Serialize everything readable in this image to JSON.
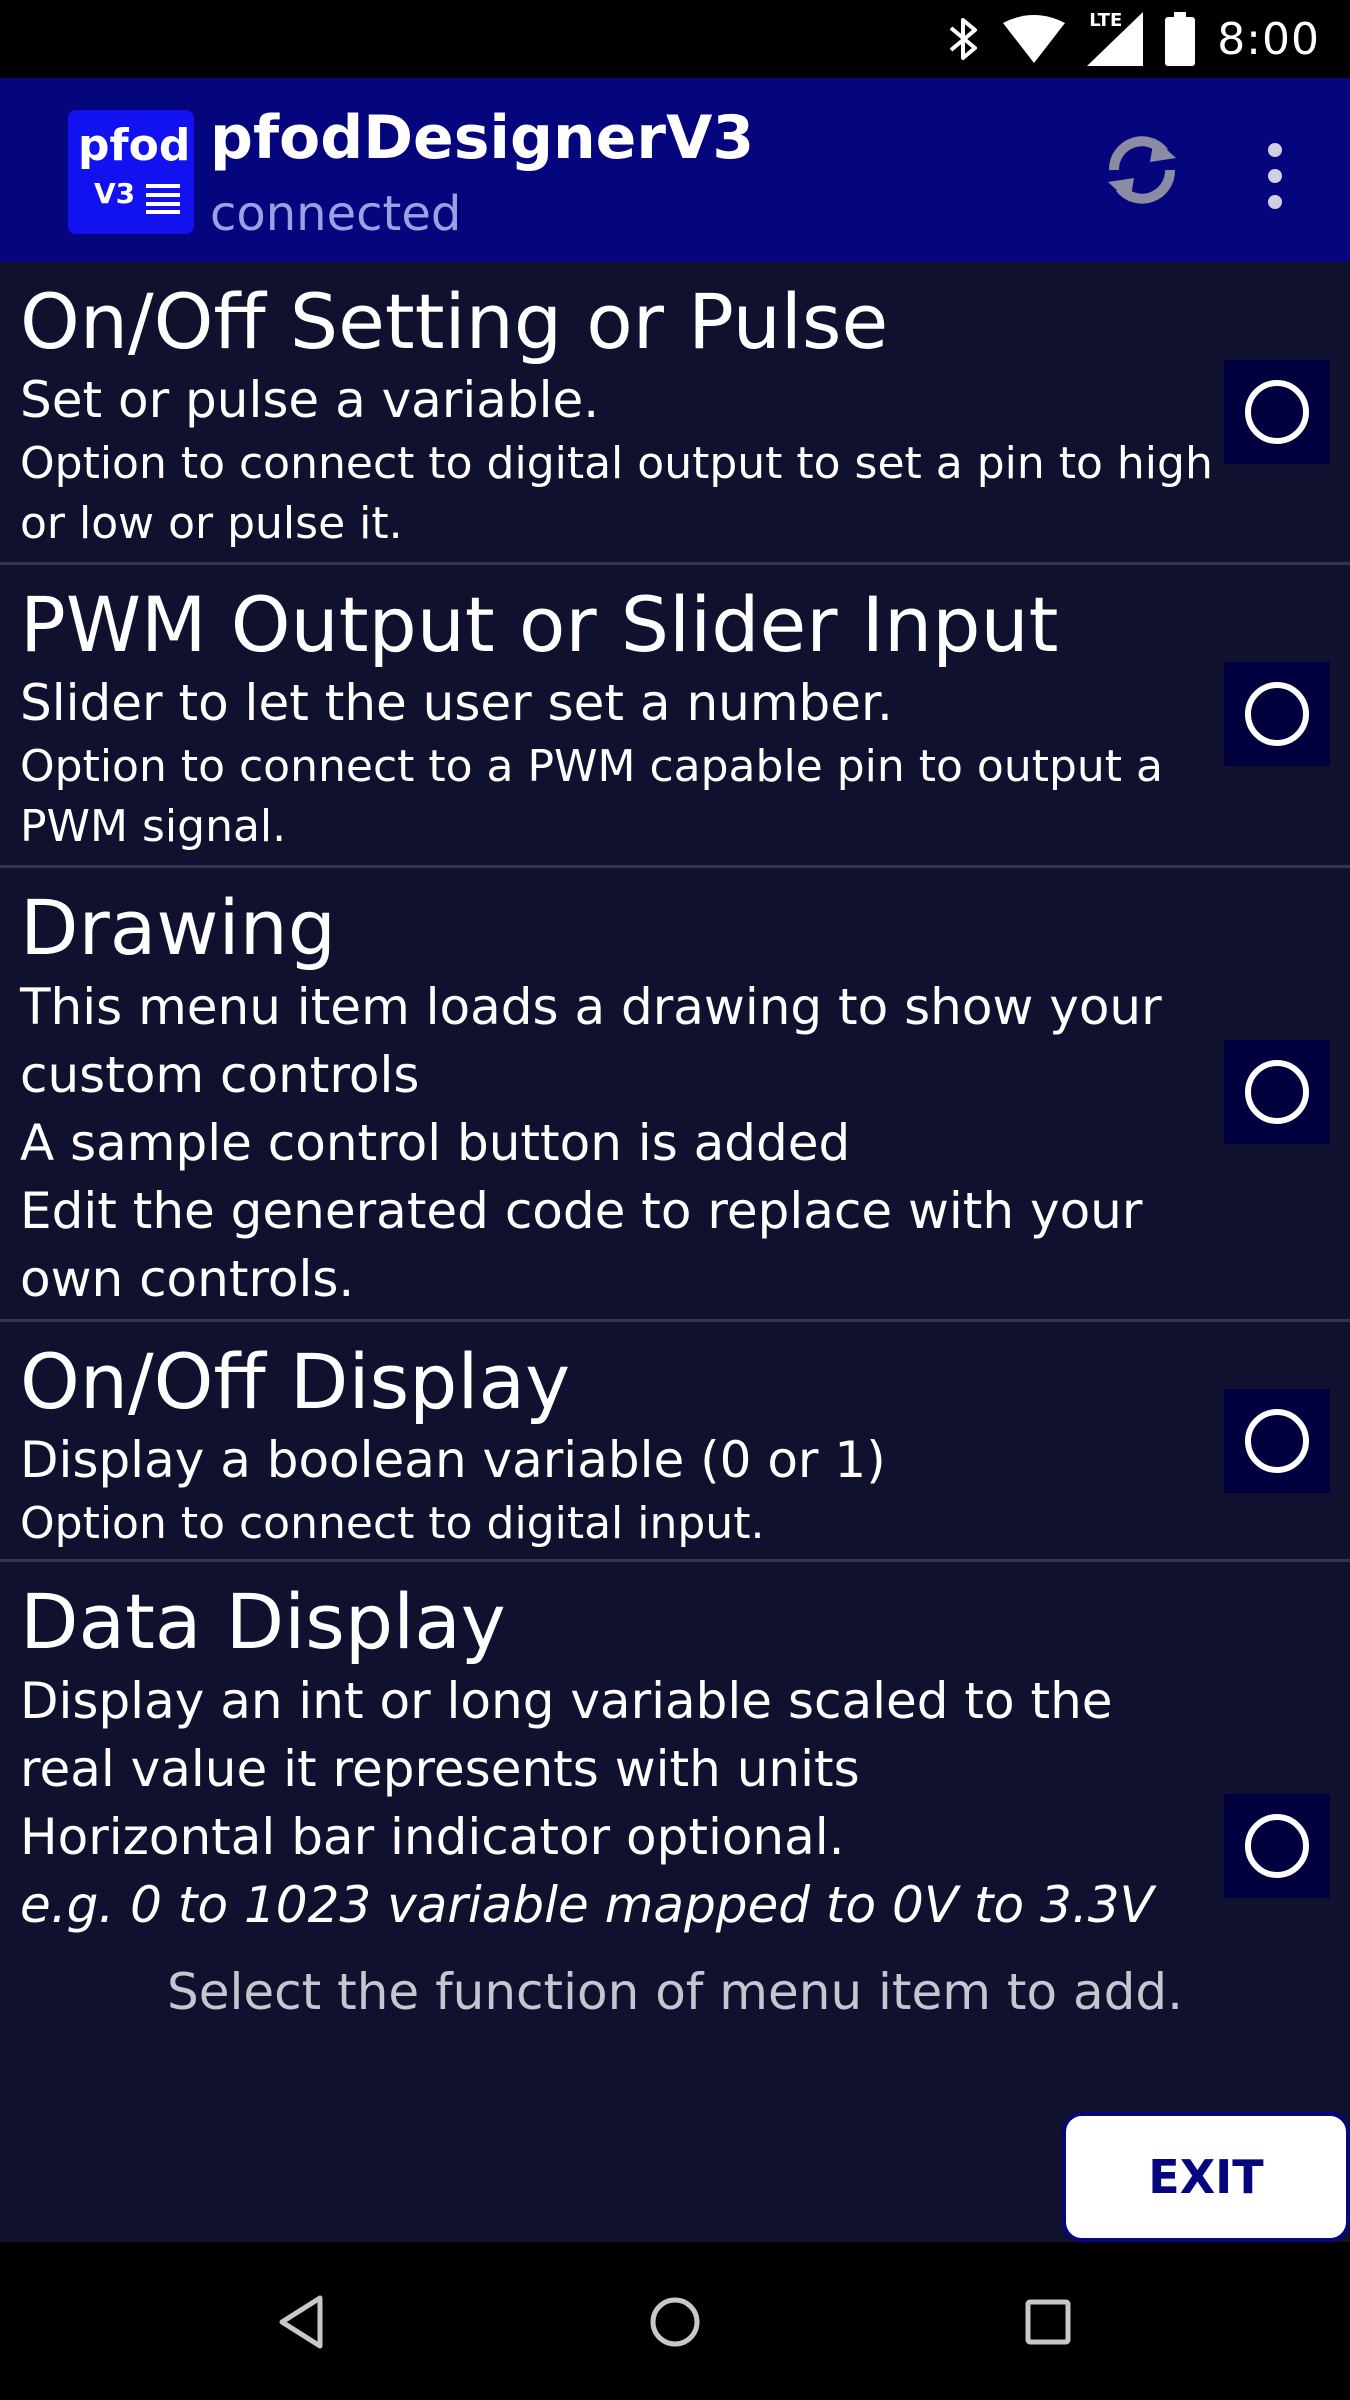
{
  "status_bar": {
    "network_label": "LTE",
    "time": "8:00",
    "icons": [
      "bluetooth-icon",
      "wifi-icon",
      "signal-icon",
      "battery-icon"
    ]
  },
  "app_bar": {
    "logo_line1": "pfod",
    "logo_line2": "V3",
    "title": "pfodDesignerV3",
    "subtitle": "connected",
    "icons": [
      "refresh-icon",
      "overflow-menu-icon"
    ]
  },
  "menu_items": [
    {
      "title": "On/Off Setting or Pulse",
      "subtitle": "Set or pulse a variable.",
      "detail": "Option to connect to digital output to set a pin to high or low or pulse it."
    },
    {
      "title": "PWM Output or Slider Input",
      "subtitle": "Slider to let the user set a number.",
      "detail": "Option to connect to a PWM capable pin to output a PWM signal."
    },
    {
      "title": "Drawing",
      "lines": [
        "This menu item loads a drawing to show your",
        "custom controls",
        "A sample control button is added",
        "Edit the generated code to replace with your",
        "own controls."
      ]
    },
    {
      "title": "On/Off Display",
      "subtitle": "Display a boolean variable (0 or 1)",
      "detail": "Option to connect to digital input."
    },
    {
      "title": "Data Display",
      "lines": [
        "Display an int or long variable scaled to the",
        "real value it represents with units",
        "Horizontal bar indicator optional."
      ],
      "example": "e.g. 0 to 1023 variable mapped to 0V to 3.3V"
    }
  ],
  "hint": "Select the function of menu item to add.",
  "exit_label": "EXIT",
  "nav_bar": [
    "back-icon",
    "home-icon",
    "recents-icon"
  ],
  "colors": {
    "app_bar": "#05057e",
    "background": "#10102f",
    "logo": "#1212f0",
    "radio_bg": "#00003f"
  }
}
